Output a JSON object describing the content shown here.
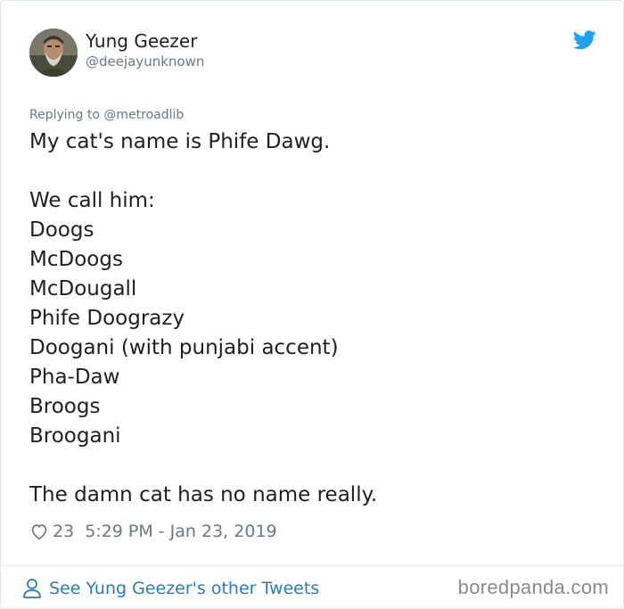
{
  "tweet": {
    "author": {
      "name": "Yung Geezer",
      "handle": "@deejayunknown",
      "avatar": "avatar-icon"
    },
    "reply_to": "Replying to @metroadlib",
    "lines": [
      "My cat's name is Phife Dawg.",
      "",
      "We call him:",
      "Doogs",
      "McDoogs",
      "McDougall",
      "Phife Doograzy",
      "Doogani (with punjabi accent)",
      "Pha-Daw",
      "Broogs",
      "Broogani",
      "",
      "The damn cat has no name really."
    ],
    "likes": "23",
    "timestamp": "5:29 PM - Jan 23, 2019"
  },
  "footer": {
    "other_tweets": "See Yung Geezer's other Tweets"
  },
  "watermark": "boredpanda.com",
  "colors": {
    "twitter_blue": "#1da1f2",
    "link_blue": "#2b7bb9",
    "muted_gray": "#697882",
    "text": "#1c2022"
  }
}
